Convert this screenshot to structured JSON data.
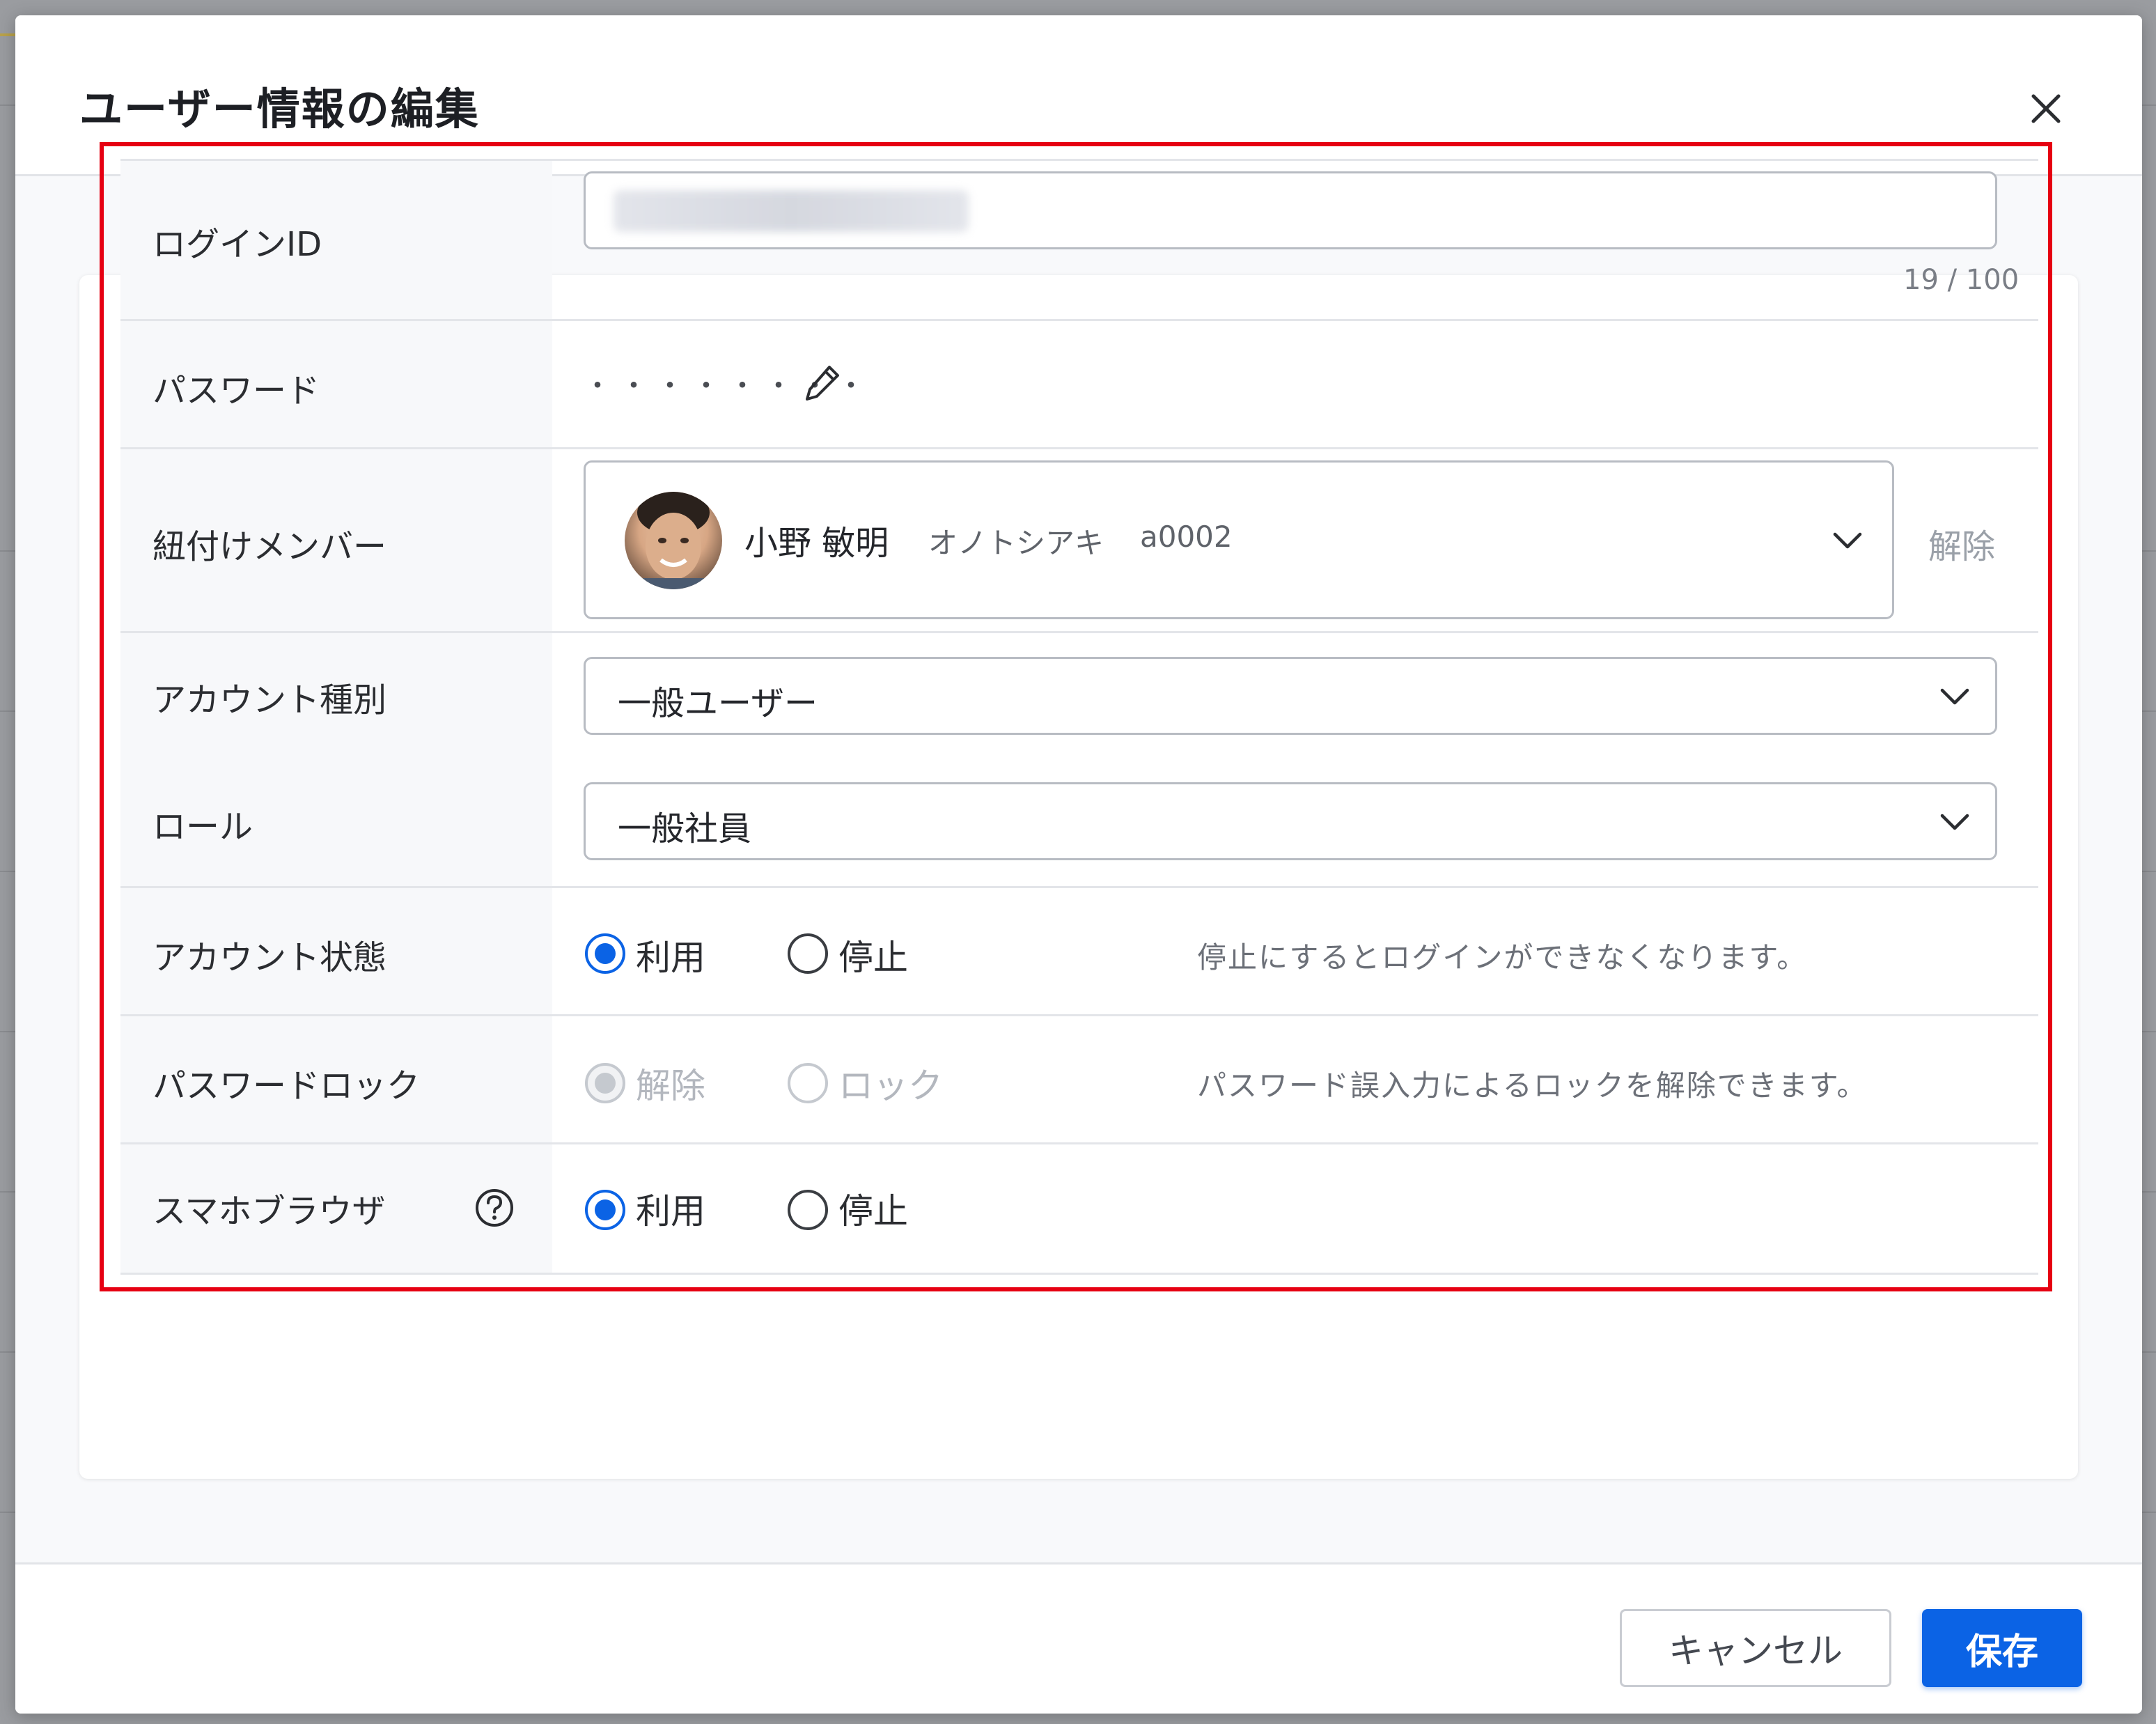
{
  "modal": {
    "title": "ユーザー情報の編集"
  },
  "fields": {
    "login_id": {
      "label": "ログインID",
      "value": "",
      "counter": "19 / 100"
    },
    "password": {
      "label": "パスワード",
      "masked_value": "・・・・・・・・",
      "edit_icon": "pencil-icon"
    },
    "linked_member": {
      "label": "紐付けメンバー",
      "name": "小野 敏明",
      "kana": "オノトシアキ",
      "code": "a0002",
      "unlink_label": "解除"
    },
    "account_type": {
      "label": "アカウント種別",
      "selected": "一般ユーザー"
    },
    "role": {
      "label": "ロール",
      "selected": "一般社員"
    },
    "account_status": {
      "label": "アカウント状態",
      "options": [
        "利用",
        "停止"
      ],
      "selected": "利用",
      "help": "停止にするとログインができなくなります。"
    },
    "password_lock": {
      "label": "パスワードロック",
      "options": [
        "解除",
        "ロック"
      ],
      "selected": "解除",
      "disabled": true,
      "help": "パスワード誤入力によるロックを解除できます。"
    },
    "smartphone_browser": {
      "label": "スマホブラウザ",
      "options": [
        "利用",
        "停止"
      ],
      "selected": "利用",
      "help_icon": "question-circle-icon"
    }
  },
  "footer": {
    "cancel_label": "キャンセル",
    "save_label": "保存"
  },
  "colors": {
    "primary": "#0b63e5",
    "highlight_border": "#e60012"
  }
}
